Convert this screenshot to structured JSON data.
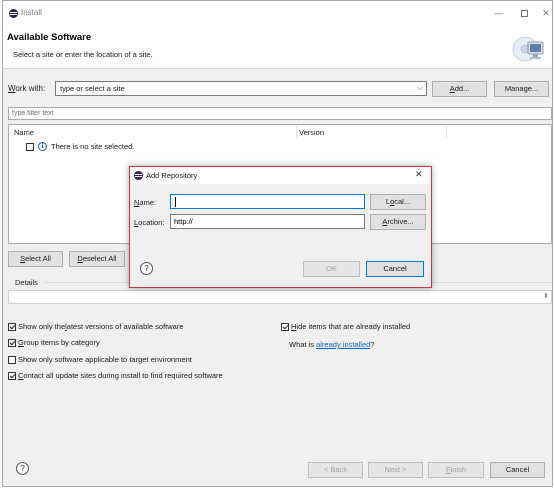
{
  "window": {
    "title": "Install",
    "minimize": "—",
    "close": "✕"
  },
  "header": {
    "title": "Available Software",
    "subtitle": "Select a site or enter the location of a site."
  },
  "work_with": {
    "label_mnemonic": "W",
    "label_rest": "ork with:",
    "placeholder": "type or select a site",
    "chevron": "⌵",
    "add_mnemonic": "A",
    "add_rest": "dd...",
    "manage_label": "Manage..."
  },
  "filter": {
    "placeholder": "type filter text"
  },
  "table": {
    "columns": [
      "Name",
      "Version"
    ],
    "row_text": "There is no site selected.",
    "info_glyph": "i"
  },
  "selection_buttons": {
    "select_all_mnemonic": "S",
    "select_all_rest": "elect All",
    "deselect_all_mnemonic": "D",
    "deselect_all_rest": "eselect All"
  },
  "details": {
    "label": "Details",
    "scroll_glyph": "⬍"
  },
  "options": {
    "latest_pre": "Show only the ",
    "latest_mn": "l",
    "latest_post": "atest versions of available software",
    "latest_checked": true,
    "group_mn": "G",
    "group_post": "roup items by category",
    "group_checked": true,
    "target": "Show only software applicable to target environment",
    "target_checked": false,
    "contact_mn": "C",
    "contact_post": "ontact all update sites during install to find required software",
    "contact_checked": true,
    "hide_mn": "H",
    "hide_post": "ide items that are already installed",
    "hide_checked": true,
    "what_is_pre": "What is ",
    "already_installed_link": "already installed",
    "what_is_post": "?"
  },
  "footer": {
    "help_glyph": "?",
    "back": "< Back",
    "back_mn": "B",
    "next": "Next >",
    "next_mn": "N",
    "finish_mn": "F",
    "finish_rest": "inish",
    "cancel": "Cancel"
  },
  "add_repository": {
    "title": "Add Repository",
    "close": "✕",
    "name_mn": "N",
    "name_rest": "ame:",
    "name_value": "",
    "location_mn": "L",
    "location_rest": "ocation:",
    "location_value": "http://",
    "local_pre": "L",
    "local_mn": "o",
    "local_post": "cal...",
    "archive_mn": "A",
    "archive_rest": "rchive...",
    "help_glyph": "?",
    "ok": "OK",
    "cancel": "Cancel"
  },
  "colors": {
    "accent": "#0078d7",
    "dialog_border": "#c0394b",
    "link": "#0066cc",
    "window_bg": "#f0f0f0"
  }
}
